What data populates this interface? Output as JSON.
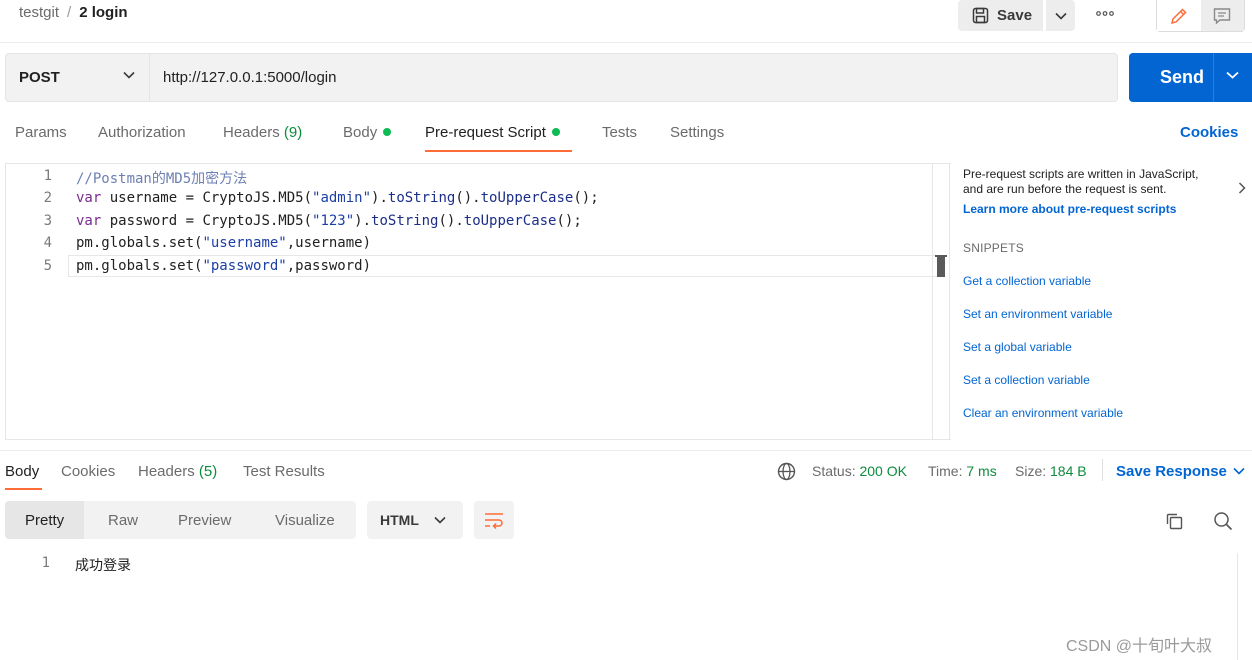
{
  "breadcrumb": {
    "collection": "testgit",
    "separator": "/",
    "request": "2 login"
  },
  "header": {
    "save_label": "Save",
    "more_label": "ooo"
  },
  "request": {
    "method": "POST",
    "url": "http://127.0.0.1:5000/login",
    "send_label": "Send"
  },
  "request_tabs": {
    "params": "Params",
    "authorization": "Authorization",
    "headers": "Headers",
    "headers_count": "(9)",
    "body": "Body",
    "prerequest": "Pre-request Script",
    "tests": "Tests",
    "settings": "Settings",
    "cookies": "Cookies"
  },
  "editor": {
    "line_numbers": [
      "1",
      "2",
      "3",
      "4",
      "5"
    ],
    "line1": "//Postman的MD5加密方法",
    "line2": {
      "kw": "var",
      "a": " username = CryptoJS.MD5(",
      "s": "\"admin\"",
      "b": ").",
      "f1": "toString",
      "c": "().",
      "f2": "toUpperCase",
      "d": "();"
    },
    "line3": {
      "kw": "var",
      "a": " password = CryptoJS.MD5(",
      "s": "\"123\"",
      "b": ").",
      "f1": "toString",
      "c": "().",
      "f2": "toUpperCase",
      "d": "();"
    },
    "line4": {
      "a": "pm.globals.set(",
      "s": "\"username\"",
      "b": ",username)"
    },
    "line5": {
      "a": "pm.globals.set(",
      "s": "\"password\"",
      "b": ",password)"
    }
  },
  "snippets": {
    "description": "Pre-request scripts are written in JavaScript, and are run before the request is sent.",
    "learn_more": "Learn more about pre-request scripts",
    "heading": "SNIPPETS",
    "items": [
      "Get a collection variable",
      "Set an environment variable",
      "Set a global variable",
      "Set a collection variable",
      "Clear an environment variable"
    ]
  },
  "response_tabs": {
    "body": "Body",
    "cookies": "Cookies",
    "headers": "Headers",
    "headers_count": "(5)",
    "test_results": "Test Results"
  },
  "response_meta": {
    "status_label": "Status:",
    "status_value": "200 OK",
    "time_label": "Time:",
    "time_value": "7 ms",
    "size_label": "Size:",
    "size_value": "184 B",
    "save_response": "Save Response"
  },
  "view_modes": [
    "Pretty",
    "Raw",
    "Preview",
    "Visualize"
  ],
  "language": "HTML",
  "response_body": {
    "line_number": "1",
    "content": "成功登录"
  },
  "watermark": "CSDN @十旬叶大叔",
  "colors": {
    "accent": "#ff6c37",
    "primary": "#0265d2",
    "success": "#0c8c3d",
    "dot": "#0cbb52"
  }
}
